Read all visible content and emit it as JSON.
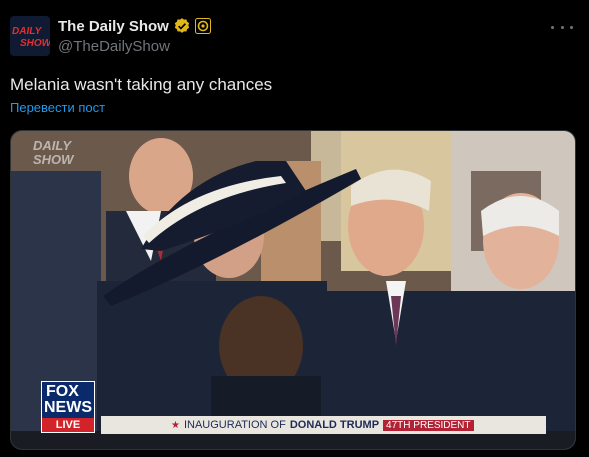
{
  "account": {
    "display_name": "The Daily Show",
    "handle": "@TheDailyShow",
    "avatar_text_line1": "DAILY",
    "avatar_text_line2": "SHOW"
  },
  "post": {
    "text": "Melania wasn't taking any chances",
    "translate_label": "Перевести пост"
  },
  "media": {
    "watermark_line1": "DAILY",
    "watermark_line2": "SHOW",
    "network_logo_line1": "FOX",
    "network_logo_line2": "NEWS",
    "network_logo_line3": "LIVE",
    "chyron_prefix": "INAUGURATION OF",
    "chyron_name": "DONALD TRUMP",
    "chyron_tag": "47TH PRESIDENT"
  },
  "icons": {
    "verified": "verified-badge-icon",
    "subscription": "subscription-badge-icon",
    "more": "more-options-icon"
  },
  "colors": {
    "background": "#000000",
    "text": "#e7e9ea",
    "muted": "#71767b",
    "link": "#1d9bf0",
    "verified_gold": "#e2b719"
  }
}
